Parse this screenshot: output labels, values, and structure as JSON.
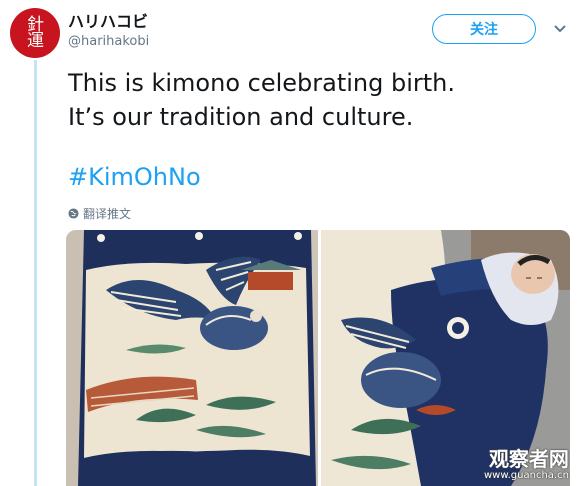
{
  "user": {
    "display_name": "ハリハコビ",
    "handle": "@harihakobi",
    "avatar_glyphs": "針運"
  },
  "header": {
    "follow_label": "关注",
    "more_icon": "chevron-down-icon"
  },
  "tweet": {
    "line1": "This is kimono celebrating birth.",
    "line2": "It’s our tradition and culture.",
    "hashtag": "#KimOhNo",
    "translate_label": "翻译推文",
    "translate_icon": "globe-icon"
  },
  "media": {
    "left_photo": "kimono with eagle design hanging",
    "right_photo": "baby wrapped in kimono"
  },
  "watermark": {
    "title": "观察者网",
    "url": "www.guancha.cn"
  },
  "colors": {
    "accent": "#1da1f2",
    "avatar_bg": "#c8141e",
    "kimono_navy": "#1e2f5c",
    "thread_line": "#c4e4f5"
  }
}
